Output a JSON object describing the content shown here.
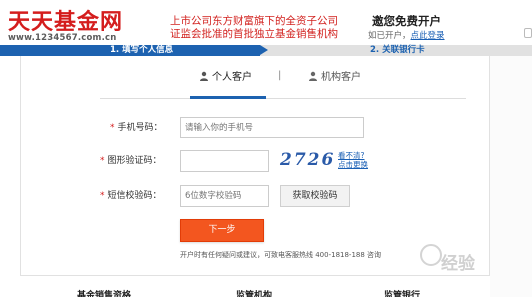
{
  "header": {
    "logo_text": "天天基金网",
    "logo_url": "www.1234567.com.cn",
    "tagline_line1": "上市公司东方财富旗下的全资子公司",
    "tagline_line2": "证监会批准的首批独立基金销售机构",
    "title": "邀您免费开户",
    "login_prompt": "如已开户，",
    "login_link": "点此登录"
  },
  "steps": {
    "step1": "1. 填写个人信息",
    "step2": "2. 关联银行卡"
  },
  "tabs": {
    "personal": "个人客户",
    "separator": "|",
    "organization": "机构客户"
  },
  "form": {
    "required_mark": "*",
    "phone_label": "手机号码：",
    "phone_placeholder": "请输入你的手机号",
    "captcha_label": "图形验证码：",
    "captcha_value": "2726",
    "captcha_help_line1": "看不清?",
    "captcha_help_line2": "点击更换",
    "sms_label": "短信校验码：",
    "sms_placeholder": "6位数字校验码",
    "sms_button": "获取校验码",
    "next_button": "下一步",
    "footnote": "开户时有任何疑问或建议，可致电客服热线 400-1818-188 咨询"
  },
  "bottom_nav": [
    "基金销售资格",
    "监管机构",
    "监管银行"
  ],
  "watermark": "经验",
  "colors": {
    "brand_red": "#d41d1d",
    "step_blue": "#1d62b0",
    "next_orange": "#f3561f"
  }
}
